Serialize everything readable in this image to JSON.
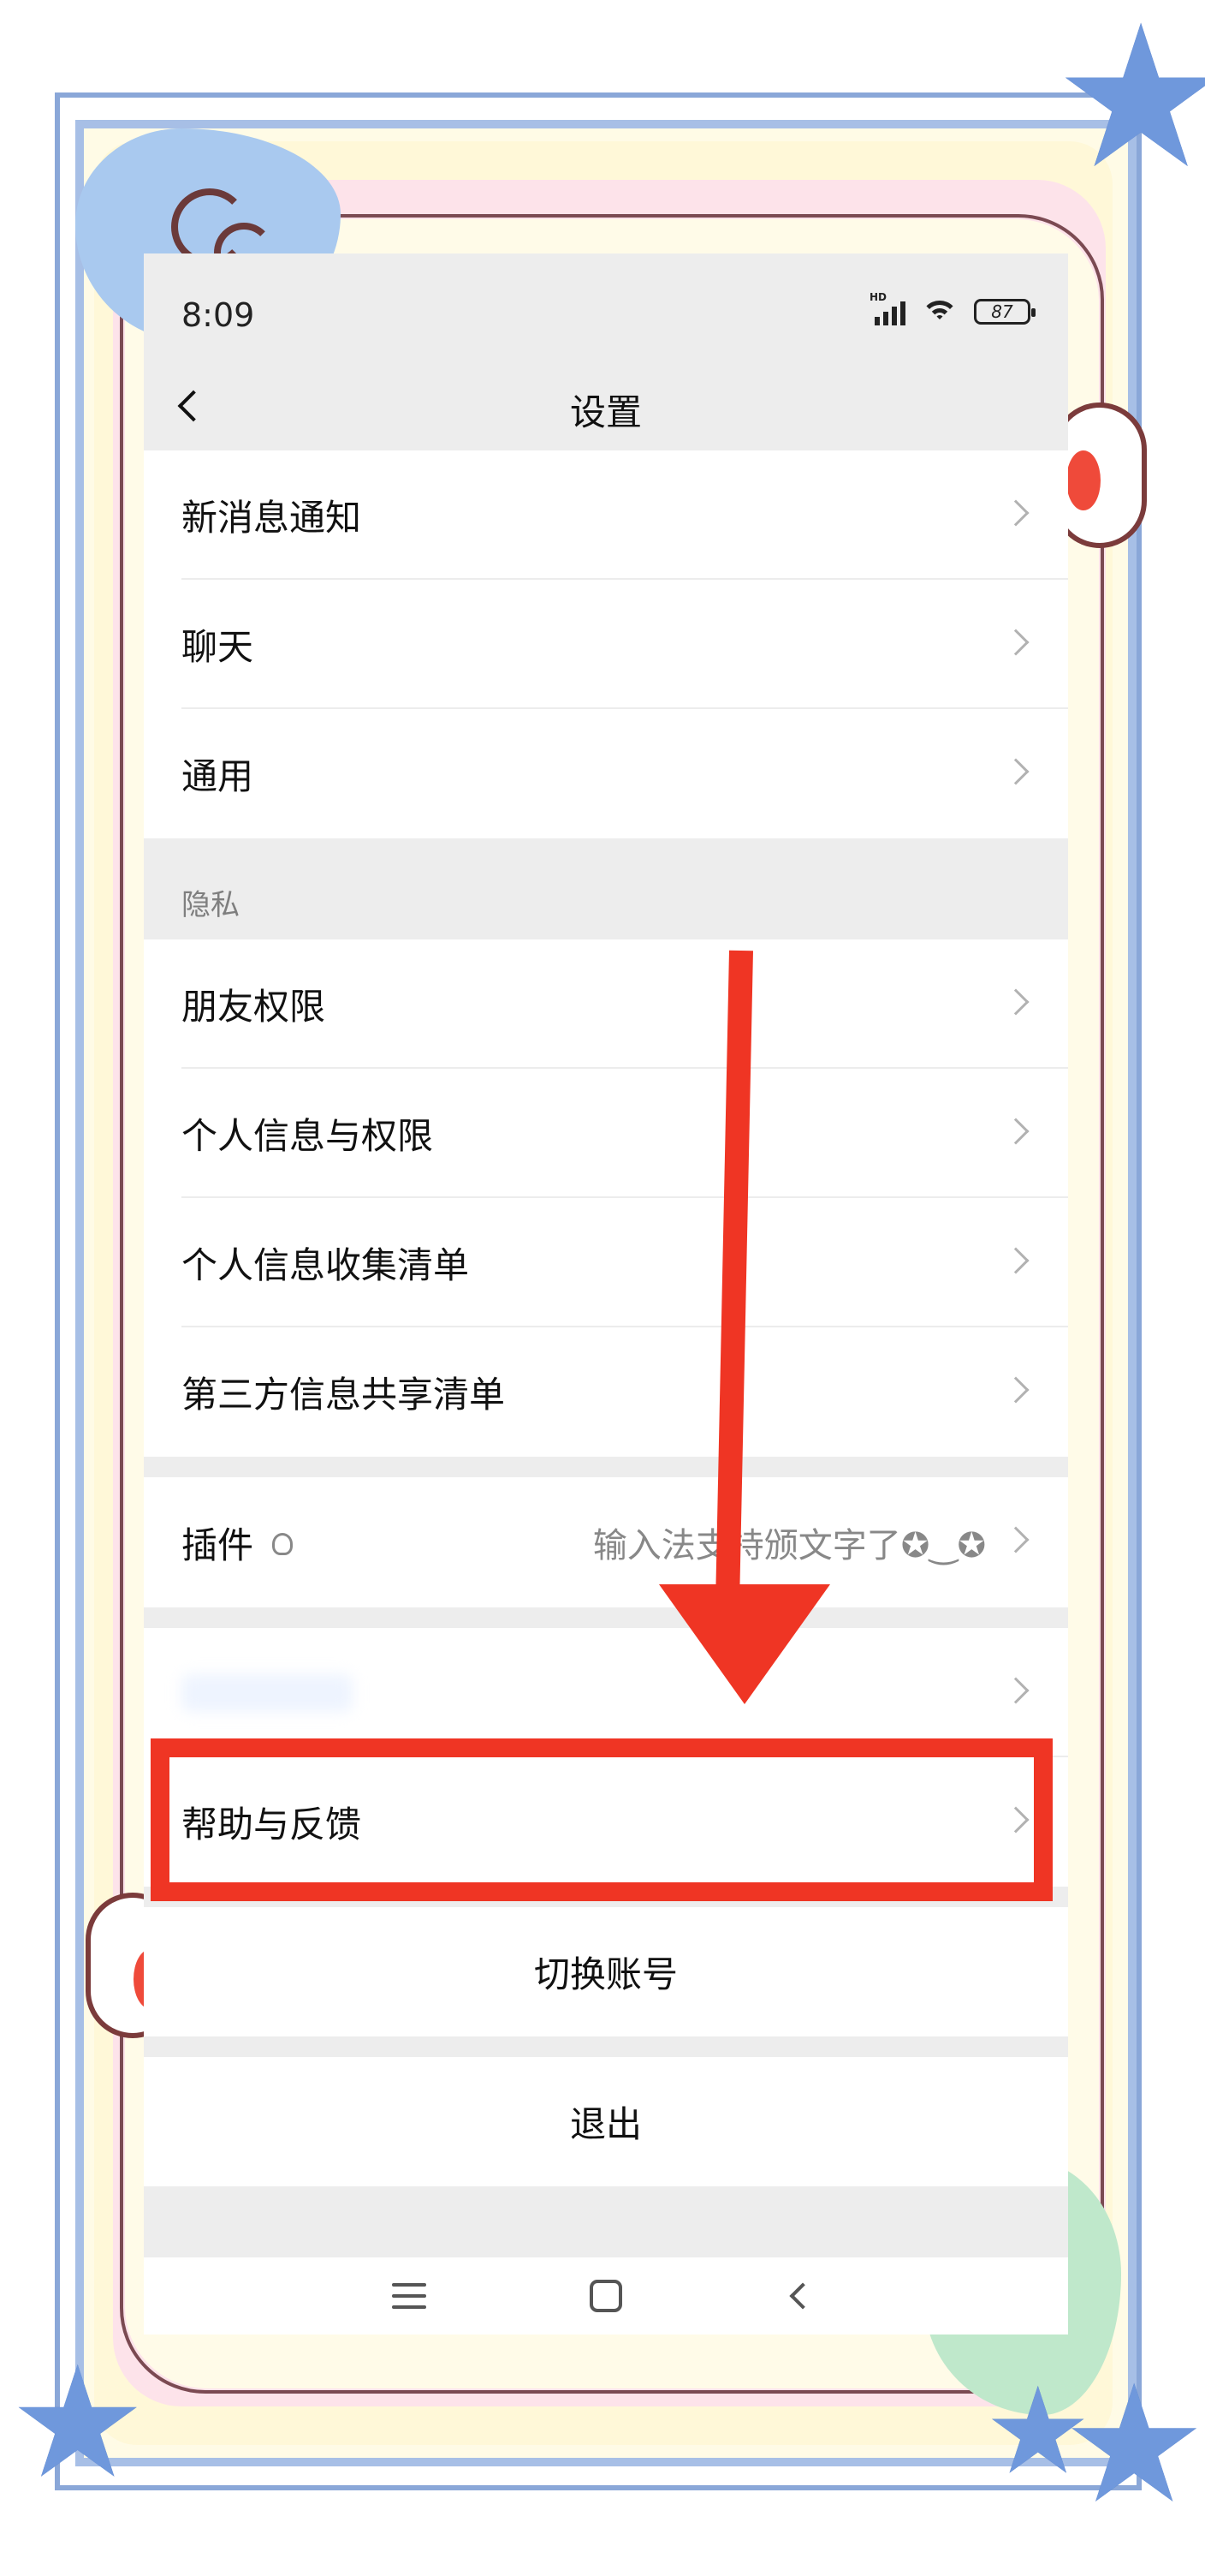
{
  "status_bar": {
    "time": "8:09",
    "signal_label": "HD",
    "battery": "87"
  },
  "nav": {
    "title": "设置"
  },
  "settings": {
    "group1": [
      "新消息通知",
      "聊天",
      "通用"
    ],
    "privacy_header": "隐私",
    "privacy_items": [
      "朋友权限",
      "个人信息与权限",
      "个人信息收集清单",
      "第三方信息共享清单"
    ],
    "plugins": {
      "label": "插件",
      "extra": "输入法支持颁文字了✪‿✪"
    },
    "help_feedback": "帮助与反馈",
    "switch_account": "切换账号",
    "logout": "退出"
  },
  "annotation": {
    "highlight_color": "#ef3524",
    "highlighted_item": "帮助与反馈"
  },
  "icons": [
    "back-chevron-icon",
    "chevron-right-icon",
    "lightbulb-icon",
    "signal-icon",
    "wifi-icon",
    "battery-icon",
    "menu-icon",
    "home-icon",
    "back-icon",
    "star-icon"
  ]
}
